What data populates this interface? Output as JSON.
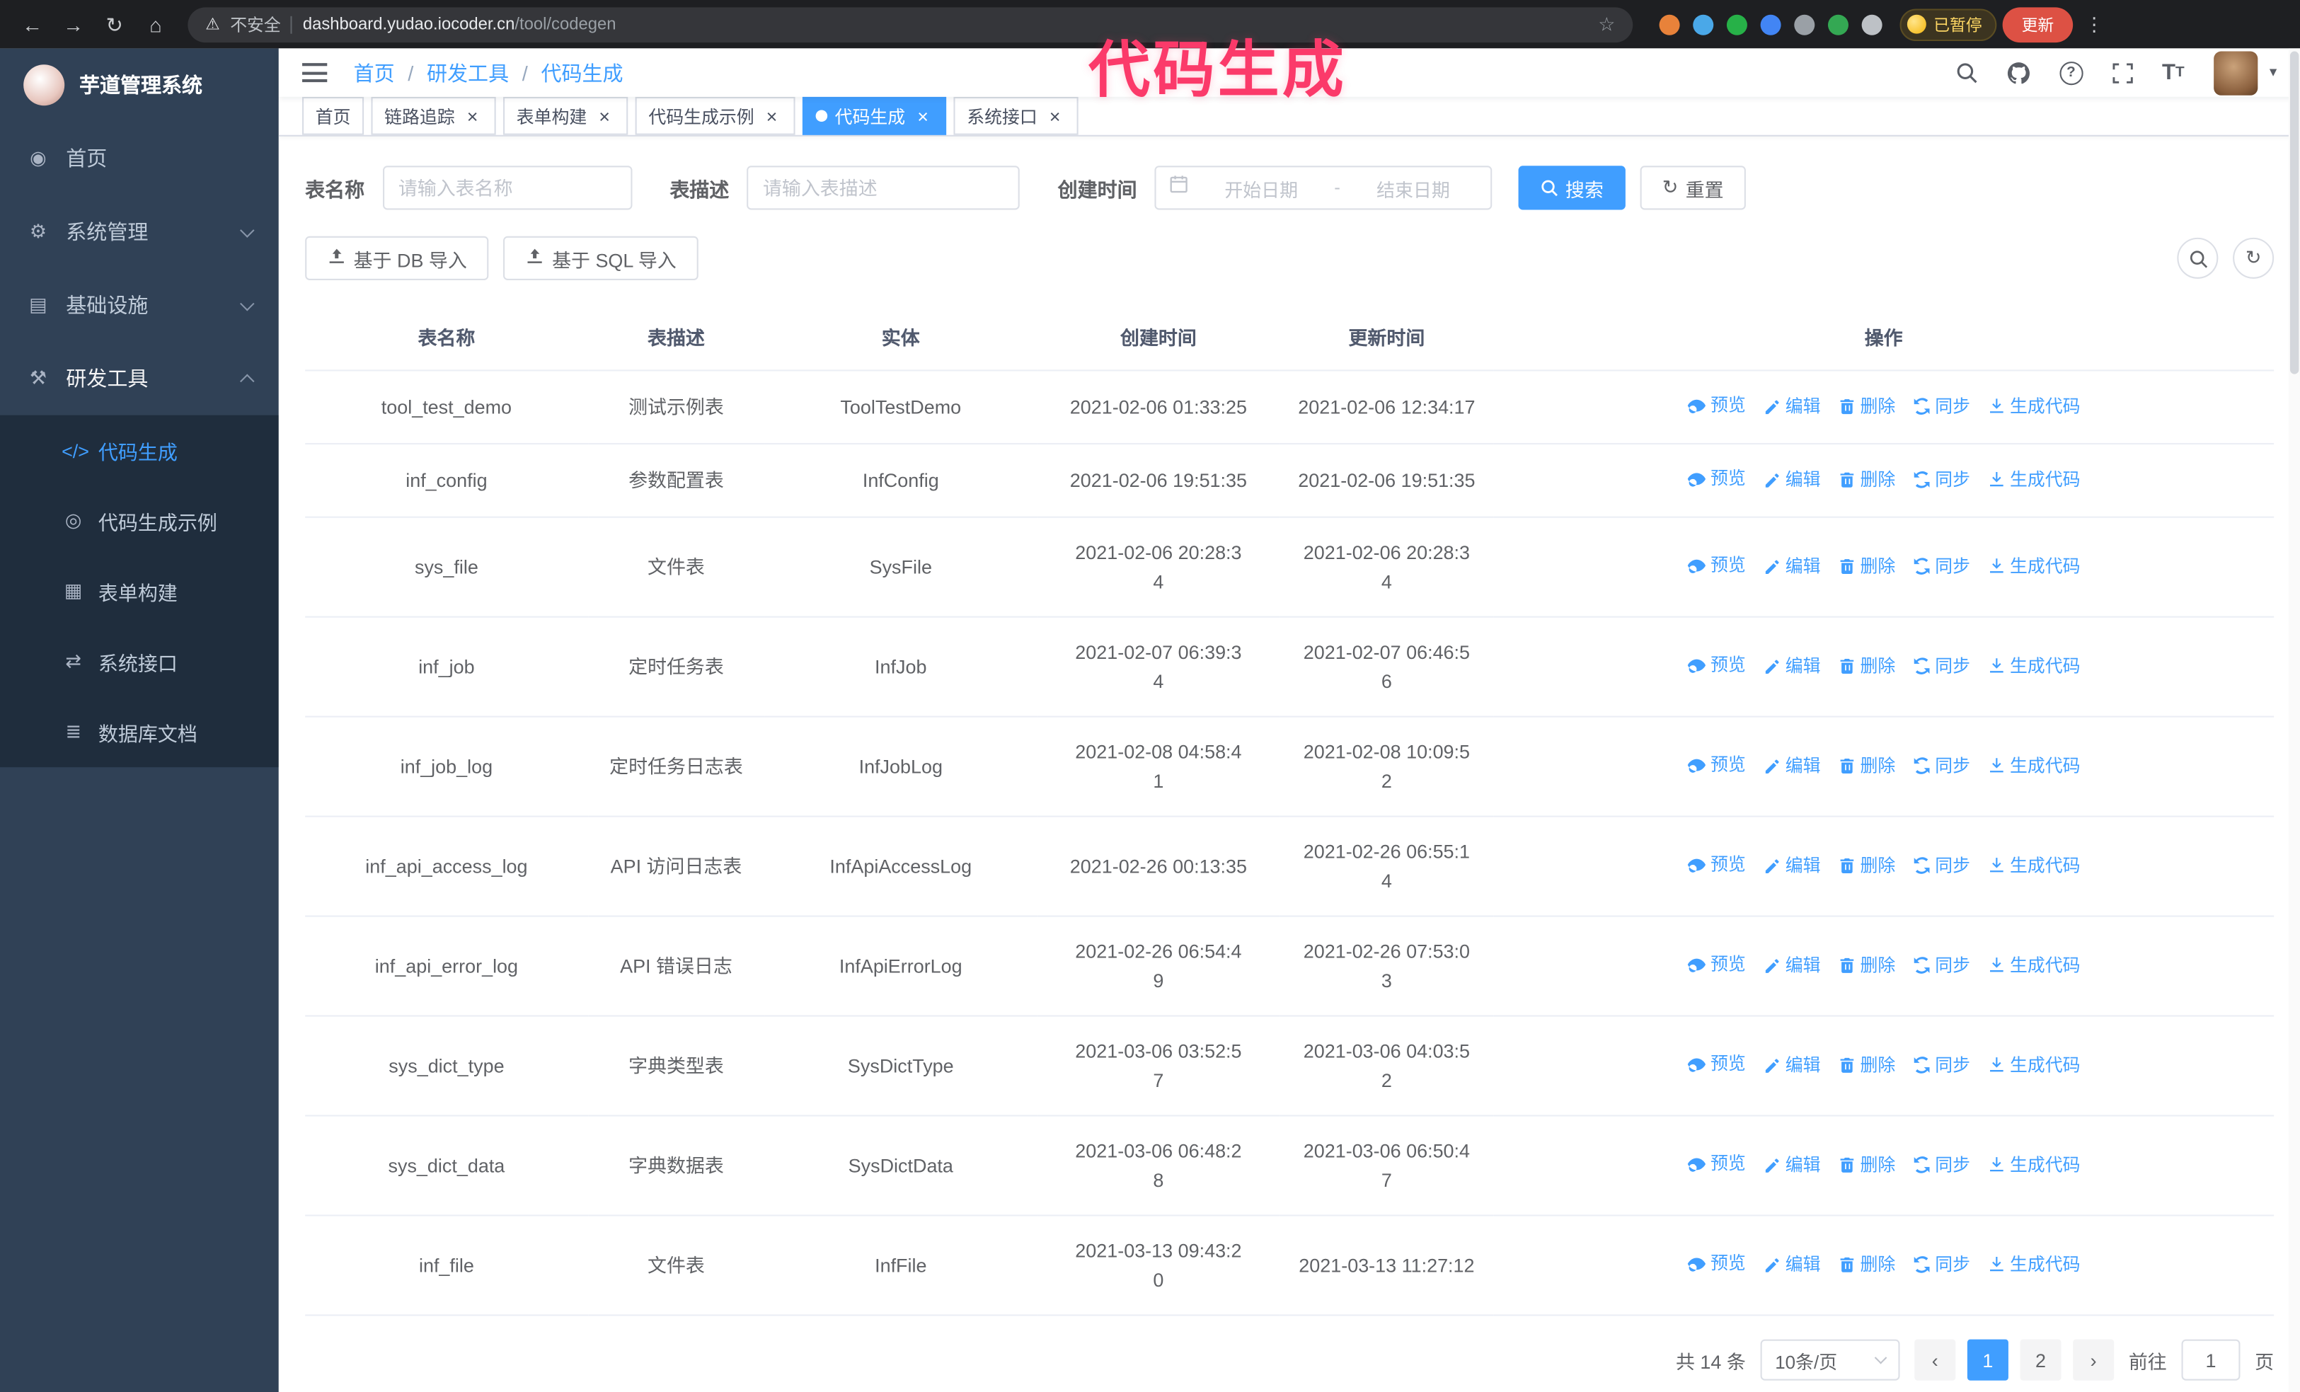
{
  "theme": {
    "accent": "#409eff",
    "sidebar_bg": "#304156",
    "sidebar_submenu_bg": "#1f2d3d",
    "annotation_color": "#fb3a6a"
  },
  "annotation": {
    "text": "代码生成"
  },
  "browser": {
    "security_text": "不安全",
    "url_host": "dashboard.yudao.iocoder.cn",
    "url_path": "/tool/codegen",
    "paused_badge": "已暂停",
    "update_button": "更新",
    "extensions": [
      {
        "name": "fox-extension",
        "color": "#e8823a"
      },
      {
        "name": "drop-extension",
        "color": "#4aa8e8"
      },
      {
        "name": "v-extension",
        "color": "#27b148"
      },
      {
        "name": "grid-extension",
        "color": "#4285f4"
      },
      {
        "name": "translate-extension",
        "color": "#9aa0a6"
      },
      {
        "name": "leaf-extension",
        "color": "#34a853"
      },
      {
        "name": "puzzle-extension",
        "color": "#bdc1c6"
      }
    ]
  },
  "sidebar": {
    "logo_title": "芋道管理系统",
    "items": [
      {
        "id": "home",
        "label": "首页",
        "icon": "dashboard-icon",
        "expandable": false,
        "expanded": false
      },
      {
        "id": "system-mgmt",
        "label": "系统管理",
        "icon": "gear-icon",
        "expandable": true,
        "expanded": false
      },
      {
        "id": "infrastructure",
        "label": "基础设施",
        "icon": "infra-icon",
        "expandable": true,
        "expanded": false
      },
      {
        "id": "dev-tools",
        "label": "研发工具",
        "icon": "tools-icon",
        "expandable": true,
        "expanded": true
      }
    ],
    "submenu": [
      {
        "id": "codegen",
        "label": "代码生成",
        "icon": "code-icon",
        "active": true
      },
      {
        "id": "codegen-example",
        "label": "代码生成示例",
        "icon": "example-icon",
        "active": false
      },
      {
        "id": "form-builder",
        "label": "表单构建",
        "icon": "form-icon",
        "active": false
      },
      {
        "id": "system-api",
        "label": "系统接口",
        "icon": "api-icon",
        "active": false
      },
      {
        "id": "db-doc",
        "label": "数据库文档",
        "icon": "database-icon",
        "active": false
      }
    ]
  },
  "header": {
    "breadcrumb": [
      "首页",
      "研发工具",
      "代码生成"
    ]
  },
  "tabs": [
    {
      "id": "home",
      "label": "首页",
      "closable": false,
      "active": false
    },
    {
      "id": "trace",
      "label": "链路追踪",
      "closable": true,
      "active": false
    },
    {
      "id": "form-builder",
      "label": "表单构建",
      "closable": true,
      "active": false
    },
    {
      "id": "codegen-example",
      "label": "代码生成示例",
      "closable": true,
      "active": false
    },
    {
      "id": "codegen",
      "label": "代码生成",
      "closable": true,
      "active": true
    },
    {
      "id": "system-api",
      "label": "系统接口",
      "closable": true,
      "active": false
    }
  ],
  "filters": {
    "table_name_label": "表名称",
    "table_name_placeholder": "请输入表名称",
    "table_desc_label": "表描述",
    "table_desc_placeholder": "请输入表描述",
    "create_time_label": "创建时间",
    "date_start_placeholder": "开始日期",
    "date_separator": "-",
    "date_end_placeholder": "结束日期",
    "search_button": "搜索",
    "reset_button": "重置"
  },
  "toolbar": {
    "import_db_button": "基于 DB 导入",
    "import_sql_button": "基于 SQL 导入"
  },
  "table": {
    "columns": [
      "表名称",
      "表描述",
      "实体",
      "创建时间",
      "更新时间",
      "操作"
    ],
    "row_actions": [
      "预览",
      "编辑",
      "删除",
      "同步",
      "生成代码"
    ],
    "rows": [
      {
        "name": "tool_test_demo",
        "desc": "测试示例表",
        "entity": "ToolTestDemo",
        "created": "2021-02-06 01:33:25",
        "updated": "2021-02-06 12:34:17"
      },
      {
        "name": "inf_config",
        "desc": "参数配置表",
        "entity": "InfConfig",
        "created": "2021-02-06 19:51:35",
        "updated": "2021-02-06 19:51:35"
      },
      {
        "name": "sys_file",
        "desc": "文件表",
        "entity": "SysFile",
        "created": "2021-02-06 20:28:3\n4",
        "updated": "2021-02-06 20:28:3\n4"
      },
      {
        "name": "inf_job",
        "desc": "定时任务表",
        "entity": "InfJob",
        "created": "2021-02-07 06:39:3\n4",
        "updated": "2021-02-07 06:46:5\n6"
      },
      {
        "name": "inf_job_log",
        "desc": "定时任务日志表",
        "entity": "InfJobLog",
        "created": "2021-02-08 04:58:4\n1",
        "updated": "2021-02-08 10:09:5\n2"
      },
      {
        "name": "inf_api_access_log",
        "desc": "API 访问日志表",
        "entity": "InfApiAccessLog",
        "created": "2021-02-26 00:13:35",
        "updated": "2021-02-26 06:55:1\n4"
      },
      {
        "name": "inf_api_error_log",
        "desc": "API 错误日志",
        "entity": "InfApiErrorLog",
        "created": "2021-02-26 06:54:4\n9",
        "updated": "2021-02-26 07:53:0\n3"
      },
      {
        "name": "sys_dict_type",
        "desc": "字典类型表",
        "entity": "SysDictType",
        "created": "2021-03-06 03:52:5\n7",
        "updated": "2021-03-06 04:03:5\n2"
      },
      {
        "name": "sys_dict_data",
        "desc": "字典数据表",
        "entity": "SysDictData",
        "created": "2021-03-06 06:48:2\n8",
        "updated": "2021-03-06 06:50:4\n7"
      },
      {
        "name": "inf_file",
        "desc": "文件表",
        "entity": "InfFile",
        "created": "2021-03-13 09:43:2\n0",
        "updated": "2021-03-13 11:27:12"
      }
    ]
  },
  "pagination": {
    "total_text": "共 14 条",
    "page_size": "10条/页",
    "pages": [
      "1",
      "2"
    ],
    "active_page": "1",
    "goto_label": "前往",
    "goto_value": "1",
    "goto_suffix": "页"
  }
}
